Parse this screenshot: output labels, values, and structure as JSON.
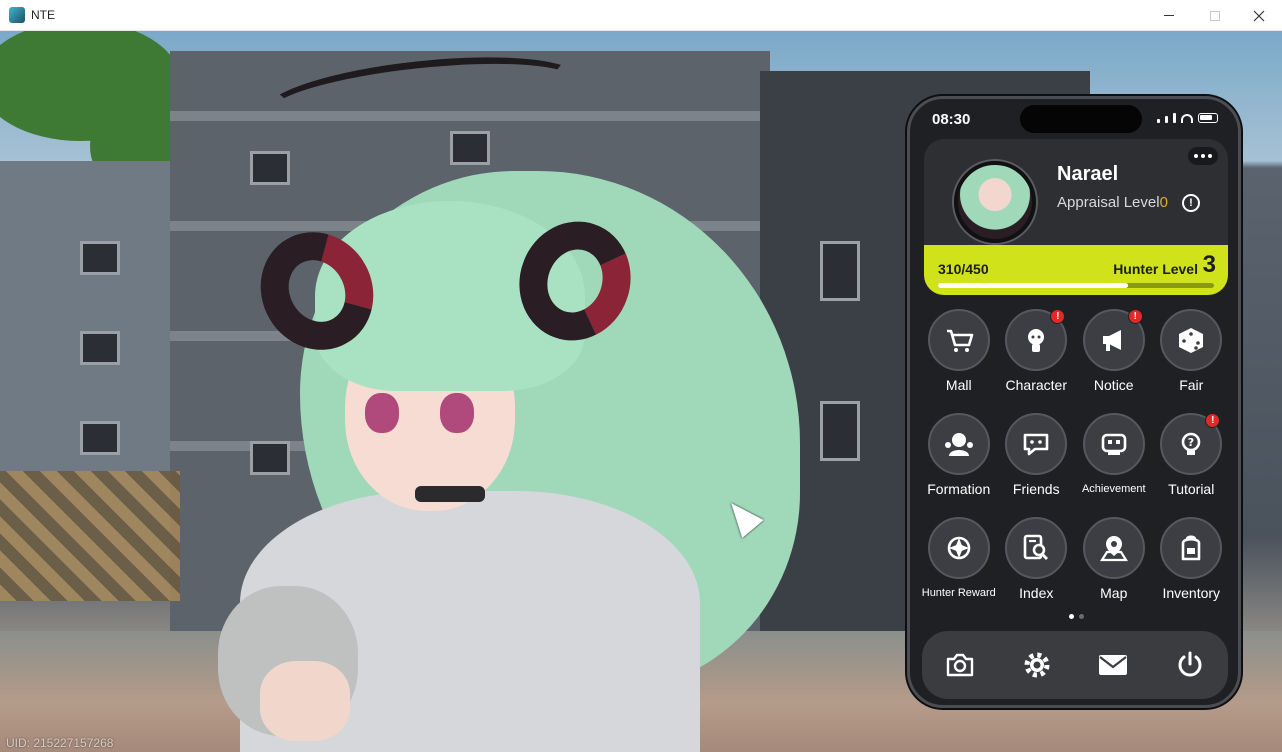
{
  "window": {
    "title": "NTE",
    "controls": [
      "minimize",
      "maximize",
      "close"
    ]
  },
  "game": {
    "uid_text": "UID: 215227157268"
  },
  "phone": {
    "time": "08:30",
    "profile": {
      "name": "Narael",
      "appraisal_label": "Appraisal Level",
      "appraisal_value": "0",
      "info_icon": "!",
      "exp_text": "310/450",
      "exp_fraction": 0.689,
      "hunter_level_label": "Hunter Level",
      "hunter_level_value": "3"
    },
    "apps": [
      {
        "label": "Mall",
        "icon": "cart-icon",
        "badge": false
      },
      {
        "label": "Character",
        "icon": "character-icon",
        "badge": true
      },
      {
        "label": "Notice",
        "icon": "megaphone-icon",
        "badge": true
      },
      {
        "label": "Fair",
        "icon": "dice-icon",
        "badge": false
      },
      {
        "label": "Formation",
        "icon": "formation-icon",
        "badge": false
      },
      {
        "label": "Friends",
        "icon": "chat-icon",
        "badge": false
      },
      {
        "label": "Achievement",
        "icon": "achievement-icon",
        "badge": false
      },
      {
        "label": "Tutorial",
        "icon": "bulb-icon",
        "badge": true
      },
      {
        "label": "Hunter Reward",
        "icon": "crosshair-icon",
        "badge": false
      },
      {
        "label": "Index",
        "icon": "index-icon",
        "badge": false
      },
      {
        "label": "Map",
        "icon": "map-icon",
        "badge": false
      },
      {
        "label": "Inventory",
        "icon": "backpack-icon",
        "badge": false
      }
    ],
    "badge_text": "!",
    "page_count": 2,
    "active_page": 1,
    "dock": [
      "camera-icon",
      "settings-icon",
      "mail-icon",
      "power-icon"
    ]
  },
  "colors": {
    "accent": "#cfe21a",
    "badge": "#e02a2a",
    "appraisal_value": "#e0ad2f"
  }
}
